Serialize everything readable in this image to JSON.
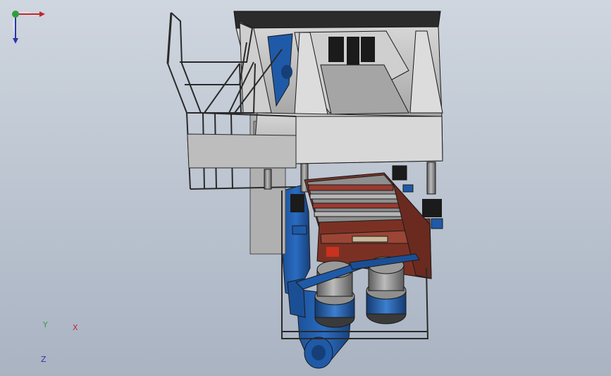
{
  "viewport": {
    "background_top": "#c8cfd9",
    "background_bottom": "#aab4c3"
  },
  "model": {
    "colors": {
      "frame_gray": "#bdbdbd",
      "frame_dark": "#6e6e6e",
      "top_plate": "#2b2b2b",
      "blue_body": "#1f5aa8",
      "blue_dark": "#163f78",
      "red_trough": "#8a3a2c",
      "red_dark": "#5e241a",
      "cylinder_gray": "#8f8f8f",
      "outline": "#1a1a1a"
    }
  },
  "triad": {
    "x_label": "X",
    "y_label": "Y",
    "z_label": "Z",
    "x_color": "#c0282d",
    "y_color": "#2e9e3c",
    "z_color": "#2a36a8"
  }
}
